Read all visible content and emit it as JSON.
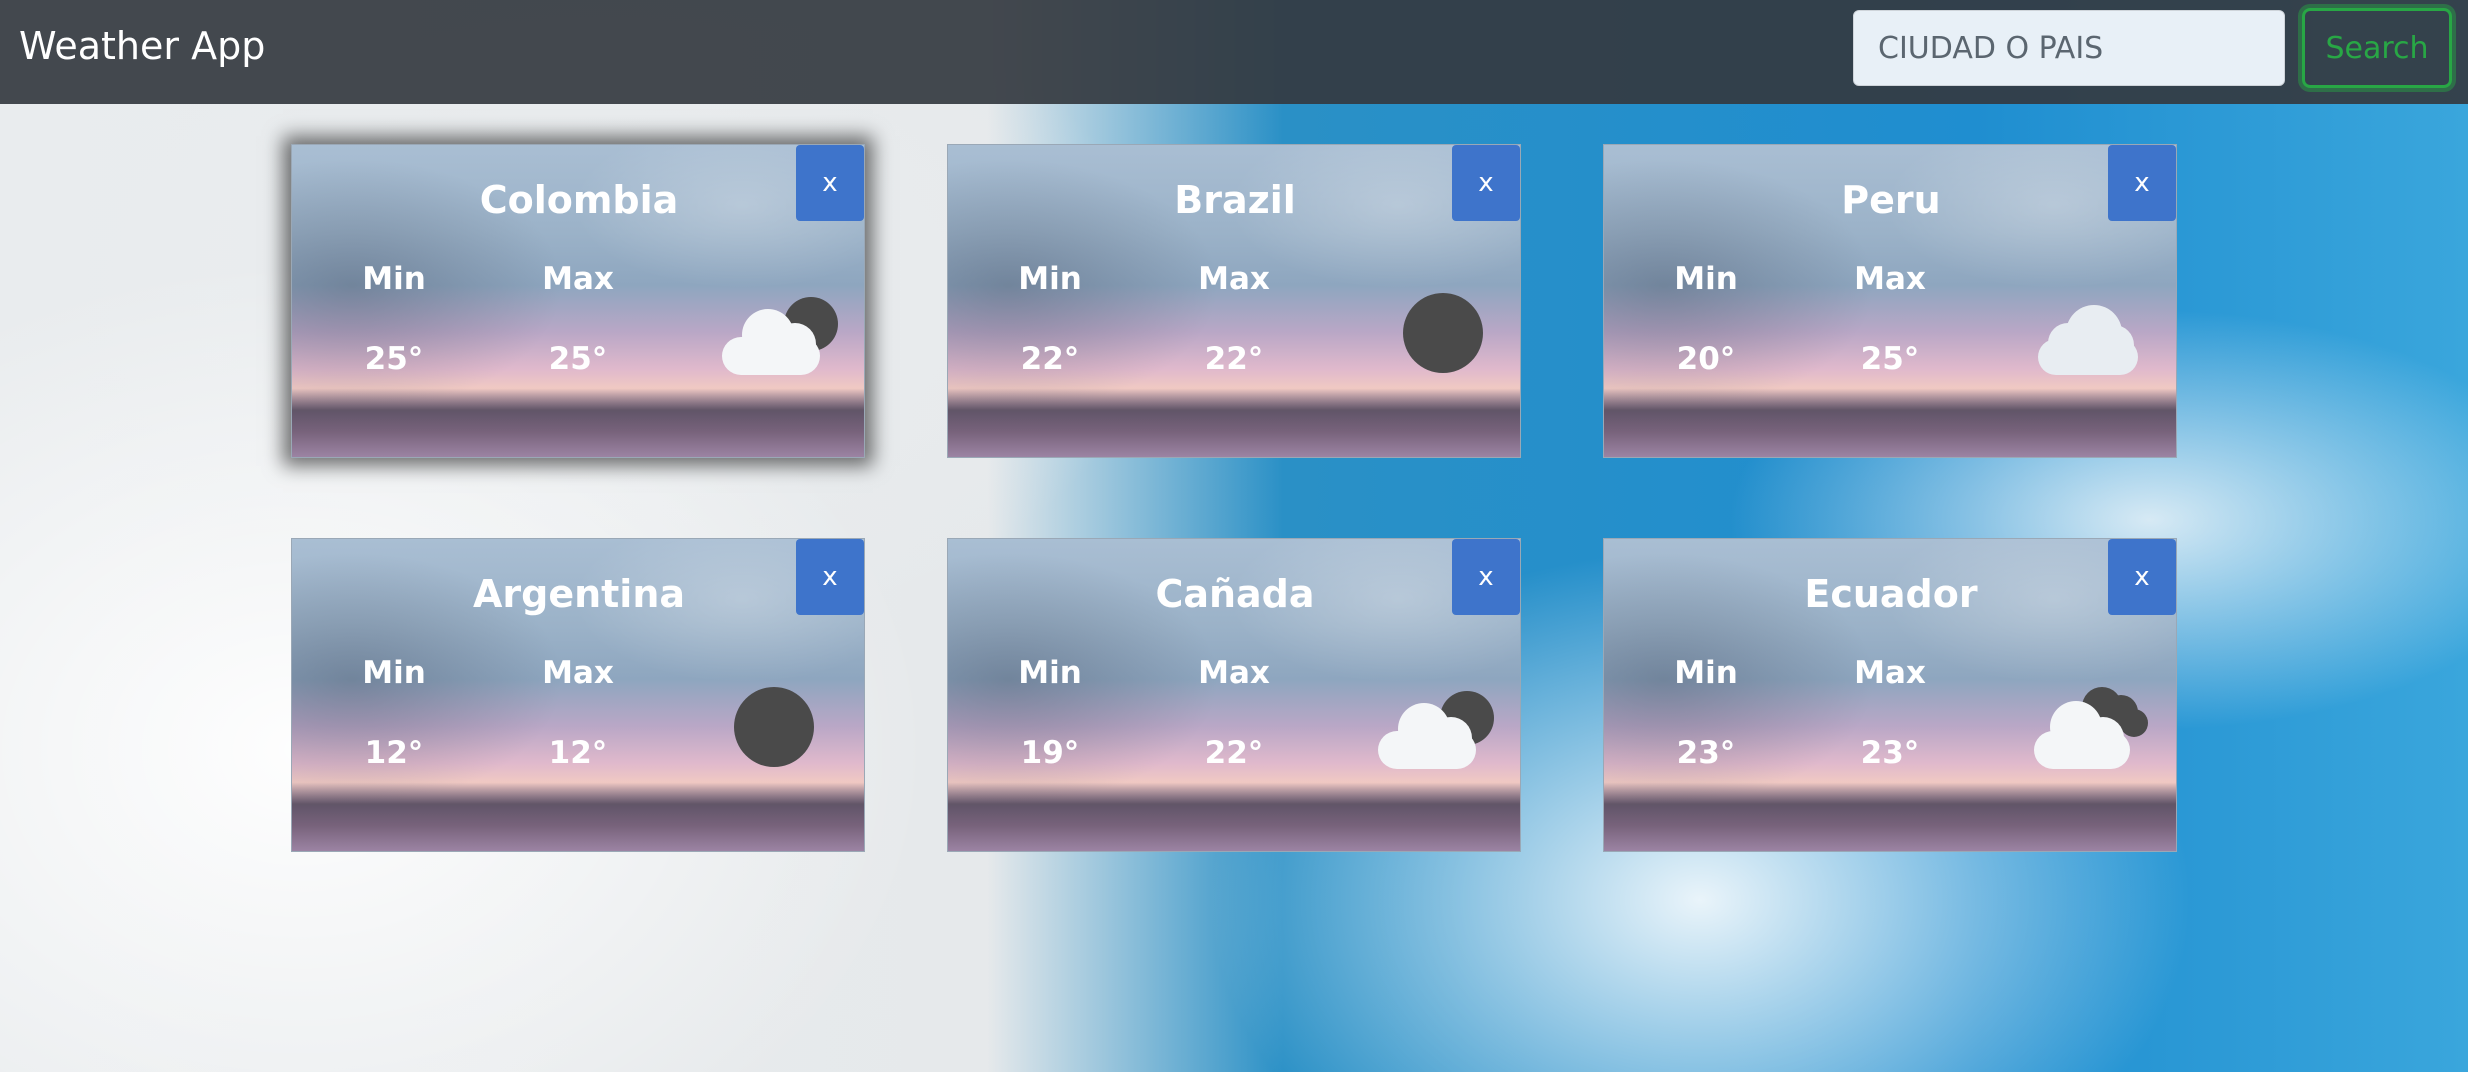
{
  "app": {
    "title": "Weather App"
  },
  "search": {
    "placeholder": "CIUDAD O PAIS",
    "button_label": "Search"
  },
  "cards": [
    {
      "city": "Colombia",
      "min_label": "Min",
      "max_label": "Max",
      "min": "25°",
      "max": "25°",
      "close_label": "x",
      "icon": "few-clouds-icon"
    },
    {
      "city": "Brazil",
      "min_label": "Min",
      "max_label": "Max",
      "min": "22°",
      "max": "22°",
      "close_label": "x",
      "icon": "clear-sky-icon"
    },
    {
      "city": "Peru",
      "min_label": "Min",
      "max_label": "Max",
      "min": "20°",
      "max": "25°",
      "close_label": "x",
      "icon": "cloud-icon"
    },
    {
      "city": "Argentina",
      "min_label": "Min",
      "max_label": "Max",
      "min": "12°",
      "max": "12°",
      "close_label": "x",
      "icon": "clear-sky-icon"
    },
    {
      "city": "Cañada",
      "min_label": "Min",
      "max_label": "Max",
      "min": "19°",
      "max": "22°",
      "close_label": "x",
      "icon": "few-clouds-icon"
    },
    {
      "city": "Ecuador",
      "min_label": "Min",
      "max_label": "Max",
      "min": "23°",
      "max": "23°",
      "close_label": "x",
      "icon": "broken-clouds-icon"
    }
  ],
  "colors": {
    "navbar": "#343a40",
    "close_button": "#3e74cb",
    "search_button": "#28a745"
  }
}
